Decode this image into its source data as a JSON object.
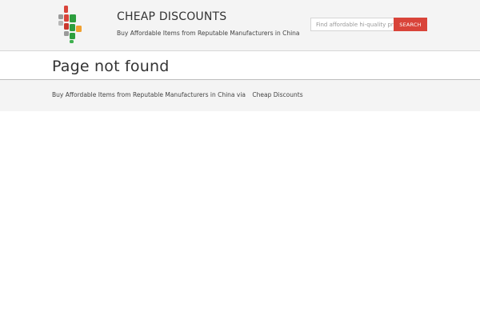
{
  "header": {
    "site_title": "CHEAP DISCOUNTS",
    "tagline": "Buy Affordable Items from Reputable Manufacturers in China",
    "logo_icon": "multicolor-cross-logo-icon"
  },
  "search": {
    "placeholder": "Find affordable hi-quality products",
    "button_label": "SEARCH"
  },
  "main": {
    "page_title": "Page not found"
  },
  "footer": {
    "text": "Buy Affordable Items from Reputable Manufacturers in China via",
    "link_label": "Cheap Discounts"
  },
  "colors": {
    "accent": "#d9443a",
    "header_bg": "#f4f4f4",
    "logo_red": "#d9443a",
    "logo_green": "#2e9e3e",
    "logo_orange": "#f0a030",
    "logo_gray": "#9a9a9a"
  }
}
